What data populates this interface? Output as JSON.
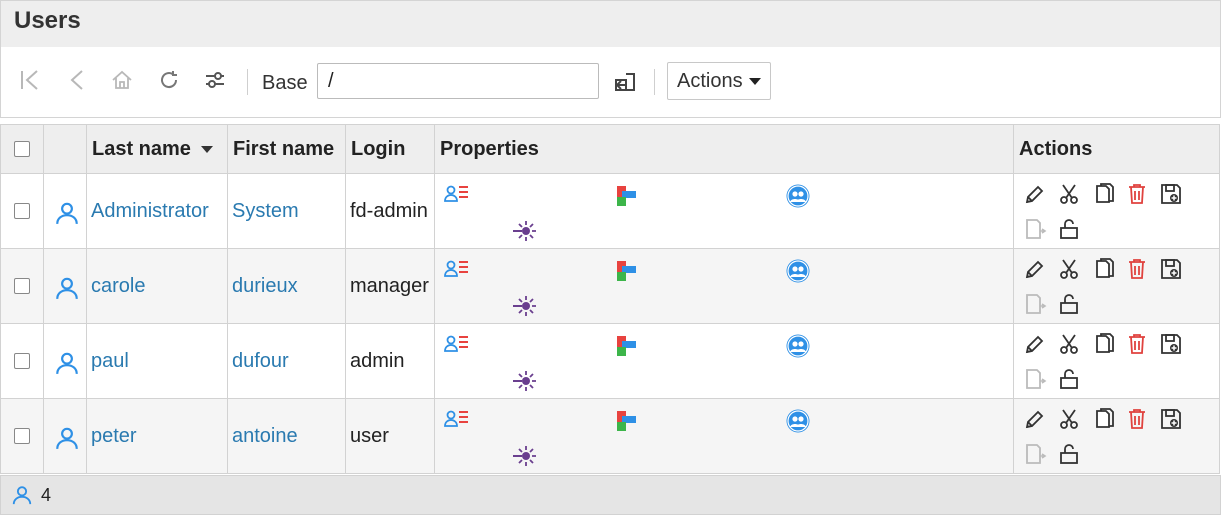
{
  "page": {
    "title": "Users"
  },
  "toolbar": {
    "icons": [
      "first-page-icon",
      "back-icon",
      "home-icon",
      "refresh-icon",
      "filter-settings-icon"
    ],
    "base_label": "Base",
    "base_value": "/",
    "submit_icon": "enter-icon",
    "actions_label": "Actions"
  },
  "table": {
    "headers": {
      "last_name": "Last name",
      "first_name": "First name",
      "login": "Login",
      "properties": "Properties",
      "actions": "Actions"
    },
    "sort": {
      "column": "Last name",
      "direction": "descending"
    },
    "rows": [
      {
        "last_name": "Administrator",
        "first_name": "System",
        "login": "fd-admin"
      },
      {
        "last_name": "carole",
        "first_name": "durieux",
        "login": "manager"
      },
      {
        "last_name": "paul",
        "first_name": "dufour",
        "login": "admin"
      },
      {
        "last_name": "peter",
        "first_name": "antoine",
        "login": "user"
      }
    ],
    "property_icons": [
      "user-info-icon",
      "posix-blocks-icon",
      "groups-icon",
      "sso-icon"
    ],
    "action_icons": [
      "edit-icon",
      "cut-icon",
      "copy-icon",
      "delete-icon",
      "save-icon",
      "paste-icon",
      "lock-icon"
    ]
  },
  "footer": {
    "count": "4",
    "icon": "user-icon"
  },
  "colors": {
    "link": "#2a7ab0",
    "delete": "#e0423e",
    "user_icon": "#2e90e6",
    "groups_icon": "#2e90e6",
    "sso_icon": "#6a3f8f"
  }
}
